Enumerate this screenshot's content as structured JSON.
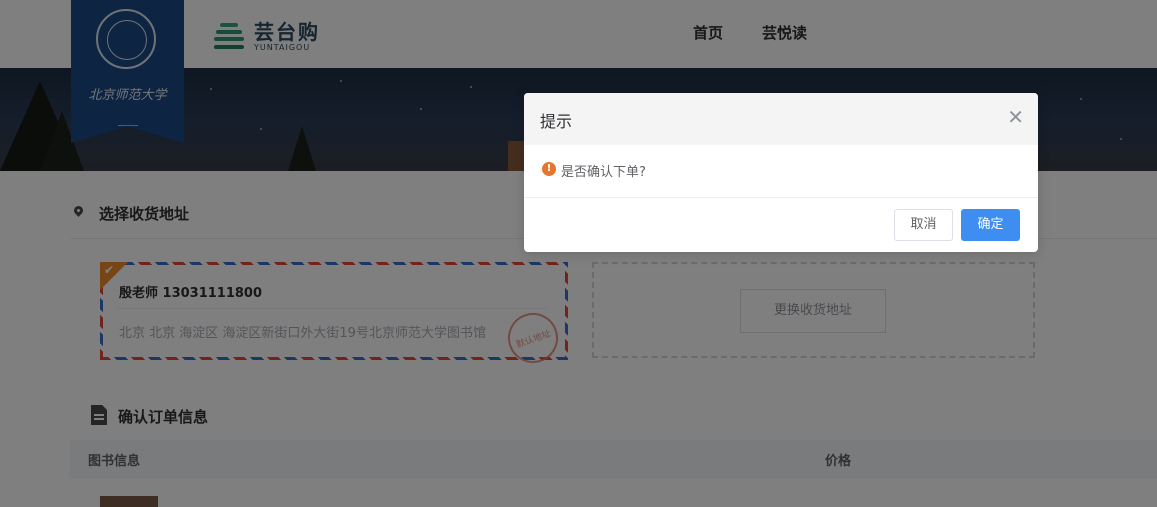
{
  "header": {
    "university_name": "北京师范大学",
    "brand_name": "芸台购",
    "brand_sub": "YUNTAIGOU",
    "nav": [
      "首页",
      "芸悦读"
    ]
  },
  "address_section": {
    "title": "选择收货地址",
    "selected": {
      "name_phone": "殷老师 13031111800",
      "address": "北京 北京 海淀区 海淀区新街口外大街19号北京师范大学图书馆",
      "stamp": "默认地址"
    },
    "change_label": "更换收货地址"
  },
  "order_section": {
    "title": "确认订单信息",
    "columns": [
      "图书信息",
      "价格"
    ]
  },
  "dialog": {
    "title": "提示",
    "message": "是否确认下单?",
    "cancel_label": "取消",
    "confirm_label": "确定",
    "colors": {
      "confirm": "#3d8ef0",
      "warning": "#e6762e"
    }
  }
}
